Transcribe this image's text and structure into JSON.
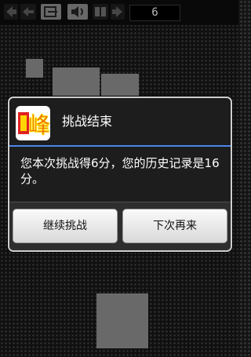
{
  "toolbar": {
    "icons": [
      "arrow-left-icon",
      "exit-icon",
      "speaker-icon",
      "restart-icon"
    ],
    "counter": "6"
  },
  "dialog": {
    "title": "挑战结束",
    "icon": "feng-logo-icon",
    "logo_text": "峰",
    "message": "您本次挑战得6分，您的历史记录是16分。",
    "buttons": {
      "continue": "继续挑战",
      "later": "下次再来"
    }
  },
  "colors": {
    "accent": "#4a86e8",
    "tile": "#808080",
    "background": "#141414"
  }
}
